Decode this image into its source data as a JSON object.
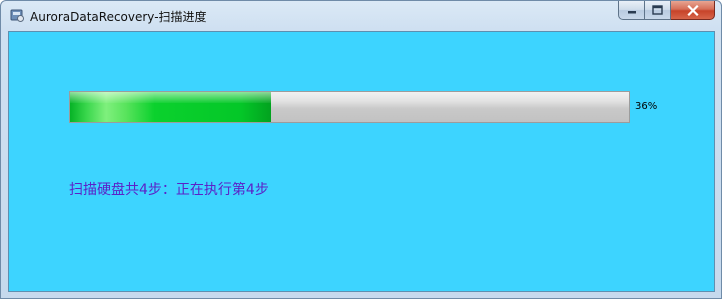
{
  "window": {
    "title": "AuroraDataRecovery-扫描进度",
    "icon": "app-icon",
    "buttons": [
      "minimize-icon",
      "maximize-icon",
      "close-icon"
    ],
    "client_background": "#3dd4ff"
  },
  "scan": {
    "progress_fraction": 0.36,
    "progress_label": "36%",
    "fill_color": "#0bd12d",
    "status": "扫描硬盘共4步：正在执行第4步",
    "status_color": "#5b22c8"
  }
}
